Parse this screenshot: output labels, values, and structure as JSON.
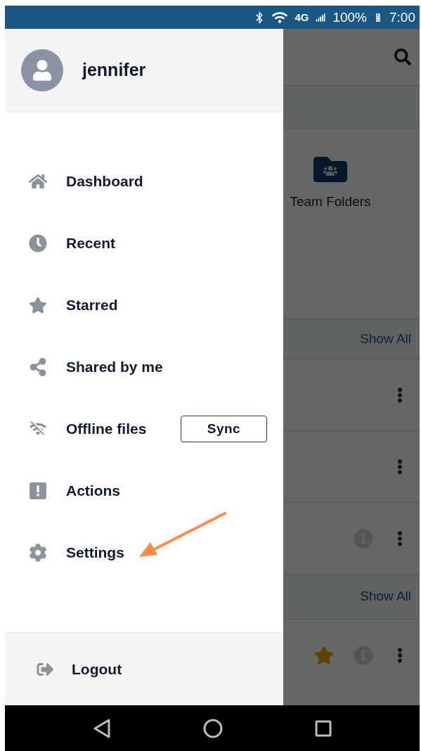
{
  "status_bar": {
    "network": "4G",
    "battery": "100%",
    "time": "7:00"
  },
  "drawer": {
    "user": "jennifer",
    "items": [
      {
        "label": "Dashboard"
      },
      {
        "label": "Recent"
      },
      {
        "label": "Starred"
      },
      {
        "label": "Shared by me"
      },
      {
        "label": "Offline files",
        "action": "Sync"
      },
      {
        "label": "Actions"
      },
      {
        "label": "Settings"
      }
    ],
    "logout": "Logout"
  },
  "background": {
    "tile": "Team Folders",
    "sections": [
      {
        "link": "Show All",
        "rows": [
          {
            "starred": false,
            "info": false
          },
          {
            "starred": false,
            "info": false
          },
          {
            "starred": false,
            "info": true
          }
        ]
      },
      {
        "link": "Show All",
        "rows": [
          {
            "starred": true,
            "info": true
          }
        ]
      }
    ]
  }
}
